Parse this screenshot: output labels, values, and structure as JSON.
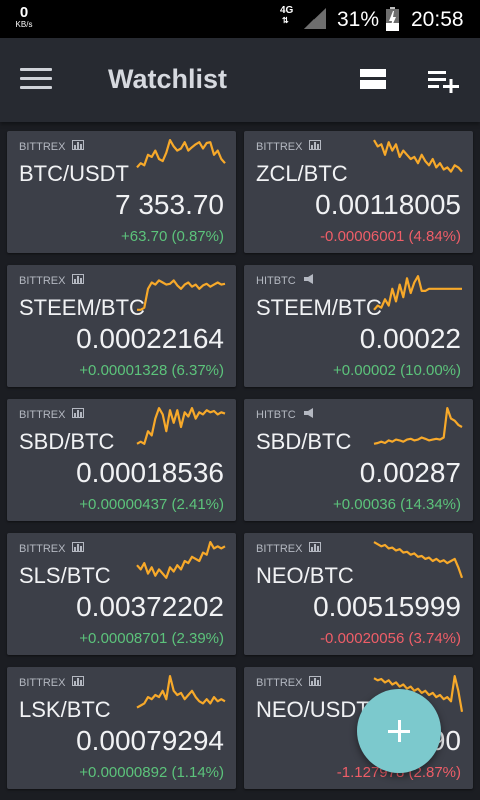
{
  "status_bar": {
    "speed_value": "0",
    "speed_unit": "KB/s",
    "network": "4G",
    "battery_percent": "31%",
    "time": "20:58"
  },
  "app_bar": {
    "title": "Watchlist",
    "menu_icon": "hamburger-menu-icon",
    "layout_icon": "view-agenda-icon",
    "add_list_icon": "playlist-add-icon"
  },
  "colors": {
    "background": "#1b1d22",
    "card": "#3c3f48",
    "positive": "#5cc37b",
    "negative": "#ef5e68",
    "sparkline": "#f7a92a",
    "fab": "#7cc9cd"
  },
  "watchlist": [
    {
      "exchange": "BITTREX",
      "exchange_icon": "bar-chart-icon",
      "pair": "BTC/USDT",
      "price": "7 353.70",
      "change": "+63.70 (0.87%)",
      "direction": "up",
      "spark": [
        0.3,
        0.4,
        0.35,
        0.6,
        0.55,
        0.7,
        0.5,
        0.45,
        0.65,
        0.95,
        0.8,
        0.7,
        0.75,
        0.9,
        0.7,
        0.78,
        0.85,
        0.9,
        0.75,
        0.88,
        0.9,
        0.6,
        0.7,
        0.5,
        0.4
      ]
    },
    {
      "exchange": "BITTREX",
      "exchange_icon": "bar-chart-icon",
      "pair": "ZCL/BTC",
      "price": "0.00118005",
      "change": "-0.00006001 (4.84%)",
      "direction": "down",
      "spark": [
        0.95,
        0.8,
        0.85,
        0.6,
        0.9,
        0.7,
        0.85,
        0.55,
        0.7,
        0.6,
        0.5,
        0.55,
        0.4,
        0.6,
        0.45,
        0.35,
        0.5,
        0.3,
        0.4,
        0.25,
        0.3,
        0.2,
        0.35,
        0.3,
        0.2
      ]
    },
    {
      "exchange": "BITTREX",
      "exchange_icon": "bar-chart-icon",
      "pair": "STEEM/BTC",
      "price": "0.00022164",
      "change": "+0.00001328 (6.37%)",
      "direction": "up",
      "spark": [
        0.1,
        0.1,
        0.15,
        0.6,
        0.75,
        0.7,
        0.8,
        0.75,
        0.7,
        0.72,
        0.8,
        0.68,
        0.6,
        0.7,
        0.75,
        0.65,
        0.7,
        0.6,
        0.68,
        0.72,
        0.65,
        0.7,
        0.75,
        0.7,
        0.72
      ]
    },
    {
      "exchange": "HITBTC",
      "exchange_icon": "megaphone-icon",
      "pair": "STEEM/BTC",
      "price": "0.00022",
      "change": "+0.00002 (10.00%)",
      "direction": "up",
      "spark": [
        0.1,
        0.2,
        0.15,
        0.35,
        0.2,
        0.6,
        0.3,
        0.7,
        0.4,
        0.85,
        0.5,
        0.75,
        0.9,
        0.55,
        0.55,
        0.6,
        0.6,
        0.6,
        0.6,
        0.6,
        0.6,
        0.6,
        0.6,
        0.6,
        0.6
      ]
    },
    {
      "exchange": "BITTREX",
      "exchange_icon": "bar-chart-icon",
      "pair": "SBD/BTC",
      "price": "0.00018536",
      "change": "+0.00000437 (2.41%)",
      "direction": "up",
      "spark": [
        0.1,
        0.15,
        0.1,
        0.4,
        0.3,
        0.7,
        0.95,
        0.8,
        0.4,
        0.9,
        0.6,
        0.9,
        0.5,
        0.85,
        0.75,
        0.95,
        0.7,
        0.85,
        0.8,
        0.9,
        0.85,
        0.88,
        0.8,
        0.85,
        0.82
      ]
    },
    {
      "exchange": "HITBTC",
      "exchange_icon": "megaphone-icon",
      "pair": "SBD/BTC",
      "price": "0.00287",
      "change": "+0.00036 (14.34%)",
      "direction": "up",
      "spark": [
        0.1,
        0.12,
        0.15,
        0.12,
        0.18,
        0.15,
        0.2,
        0.18,
        0.15,
        0.2,
        0.22,
        0.18,
        0.2,
        0.25,
        0.22,
        0.18,
        0.2,
        0.22,
        0.2,
        0.25,
        0.95,
        0.7,
        0.65,
        0.55,
        0.5
      ]
    },
    {
      "exchange": "BITTREX",
      "exchange_icon": "bar-chart-icon",
      "pair": "SLS/BTC",
      "price": "0.00372202",
      "change": "+0.00008701 (2.39%)",
      "direction": "up",
      "spark": [
        0.4,
        0.3,
        0.45,
        0.2,
        0.35,
        0.15,
        0.3,
        0.2,
        0.1,
        0.35,
        0.25,
        0.4,
        0.3,
        0.5,
        0.45,
        0.6,
        0.55,
        0.5,
        0.7,
        0.65,
        0.95,
        0.8,
        0.85,
        0.8,
        0.85
      ]
    },
    {
      "exchange": "BITTREX",
      "exchange_icon": "bar-chart-icon",
      "pair": "NEO/BTC",
      "price": "0.00515999",
      "change": "-0.00020056 (3.74%)",
      "direction": "down",
      "spark": [
        0.95,
        0.9,
        0.85,
        0.88,
        0.8,
        0.82,
        0.75,
        0.78,
        0.7,
        0.72,
        0.65,
        0.68,
        0.6,
        0.62,
        0.55,
        0.58,
        0.5,
        0.55,
        0.48,
        0.52,
        0.45,
        0.5,
        0.55,
        0.35,
        0.1
      ]
    },
    {
      "exchange": "BITTREX",
      "exchange_icon": "bar-chart-icon",
      "pair": "LSK/BTC",
      "price": "0.00079294",
      "change": "+0.00000892 (1.14%)",
      "direction": "up",
      "spark": [
        0.2,
        0.25,
        0.3,
        0.45,
        0.4,
        0.5,
        0.45,
        0.6,
        0.4,
        0.95,
        0.6,
        0.5,
        0.55,
        0.4,
        0.5,
        0.6,
        0.45,
        0.35,
        0.3,
        0.4,
        0.3,
        0.45,
        0.35,
        0.4,
        0.35
      ]
    },
    {
      "exchange": "BITTREX",
      "exchange_icon": "bar-chart-icon",
      "pair": "NEO/USDT",
      "price": "384.90",
      "change": "-1.127978 (2.87%)",
      "direction": "down",
      "spark": [
        0.9,
        0.85,
        0.88,
        0.8,
        0.85,
        0.75,
        0.8,
        0.7,
        0.75,
        0.65,
        0.7,
        0.6,
        0.65,
        0.55,
        0.6,
        0.5,
        0.55,
        0.45,
        0.5,
        0.4,
        0.45,
        0.35,
        0.95,
        0.6,
        0.1
      ]
    }
  ],
  "fab": {
    "icon": "plus-icon"
  }
}
